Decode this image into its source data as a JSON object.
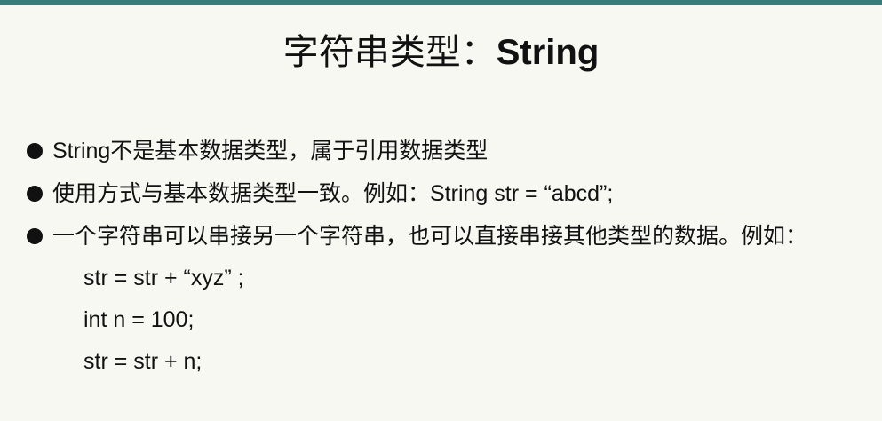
{
  "slide": {
    "title_cn": "字符串类型：",
    "title_en": "String",
    "bullets": [
      "String不是基本数据类型，属于引用数据类型",
      "使用方式与基本数据类型一致。例如：String str = “abcd”;",
      "一个字符串可以串接另一个字符串，也可以直接串接其他类型的数据。例如："
    ],
    "code_lines": [
      "str = str + “xyz” ;",
      "int n = 100;",
      "str = str + n;"
    ]
  },
  "colors": {
    "background": "#f8f8f3",
    "top_rule": "#3a7a78",
    "text": "#111111"
  },
  "icons": {
    "bullet": "filled-circle-bullet"
  }
}
